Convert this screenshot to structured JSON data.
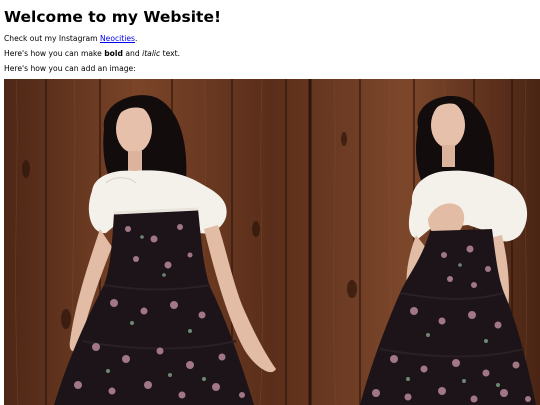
{
  "heading": "Welcome to my Website!",
  "instagram_line": {
    "prefix": "Check out my Instagram ",
    "link_text": "Neocities",
    "suffix": "."
  },
  "formatting_line": {
    "prefix": "Here's how you can make ",
    "bold_text": "bold",
    "middle": " and ",
    "italic_text": "italic",
    "suffix": " text."
  },
  "image_line": "Here's how you can add an image:",
  "image": {
    "subject": "two-panel photo of a woman in a white puff-sleeve blouse and black floral dress against wooden plank wall",
    "colors": {
      "wood": "#6b3a22",
      "wood_dark": "#3a1c10",
      "blouse": "#f4f1ea",
      "dress": "#1c1418",
      "hair": "#120c0c",
      "skin": "#e6c0aa"
    }
  }
}
